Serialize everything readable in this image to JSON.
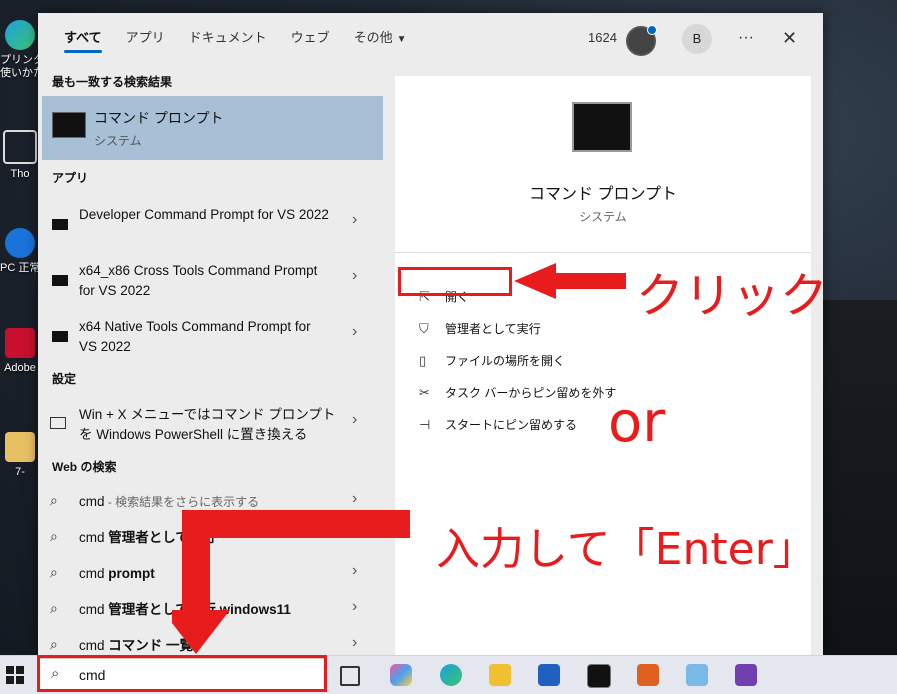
{
  "desktop": {
    "icons": [
      {
        "label": "プリンター\n使いかた",
        "name": "edge"
      },
      {
        "label": "Tho",
        "name": "app"
      },
      {
        "label": "PC 正常",
        "name": "pc-health"
      },
      {
        "label": "Adobe",
        "name": "adobe"
      },
      {
        "label": "7-",
        "name": "folder"
      }
    ]
  },
  "header": {
    "tabs": [
      "すべて",
      "アプリ",
      "ドキュメント",
      "ウェブ",
      "その他"
    ],
    "points": "1624",
    "avatar": "B",
    "more": "···",
    "close": "✕"
  },
  "results": {
    "best_heading": "最も一致する検索結果",
    "best": {
      "title": "コマンド プロンプト",
      "subtitle": "システム"
    },
    "apps_heading": "アプリ",
    "apps": [
      "Developer Command Prompt for VS 2022",
      "x64_x86 Cross Tools Command Prompt for VS 2022",
      "x64 Native Tools Command Prompt for VS 2022"
    ],
    "settings_heading": "設定",
    "settings": [
      "Win + X メニューではコマンド プロンプトを Windows PowerShell に置き換える"
    ],
    "web_heading": "Web の検索",
    "web": [
      {
        "query": "cmd",
        "extra": " - 検索結果をさらに表示する"
      },
      {
        "query": "cmd ",
        "extra": "管理者として実行"
      },
      {
        "query": "cmd ",
        "extra": "prompt"
      },
      {
        "query": "cmd ",
        "extra": "管理者として実行 windows11"
      },
      {
        "query": "cmd ",
        "extra": "コマンド 一覧"
      }
    ]
  },
  "detail": {
    "title": "コマンド プロンプト",
    "subtitle": "システム",
    "actions": [
      {
        "label": "開く",
        "icon": "open-icon"
      },
      {
        "label": "管理者として実行",
        "icon": "shield-icon"
      },
      {
        "label": "ファイルの場所を開く",
        "icon": "file-icon"
      },
      {
        "label": "タスク バーからピン留めを外す",
        "icon": "unpin-icon"
      },
      {
        "label": "スタートにピン留めする",
        "icon": "pin-icon"
      }
    ]
  },
  "annotations": {
    "click": "クリック",
    "or": "or",
    "enter": "入力して「Enter」"
  },
  "taskbar": {
    "search_value": "cmd"
  },
  "colors": {
    "accent": "#0067c0",
    "annotation": "#e81c1c",
    "selected": "#a8c0d6"
  }
}
